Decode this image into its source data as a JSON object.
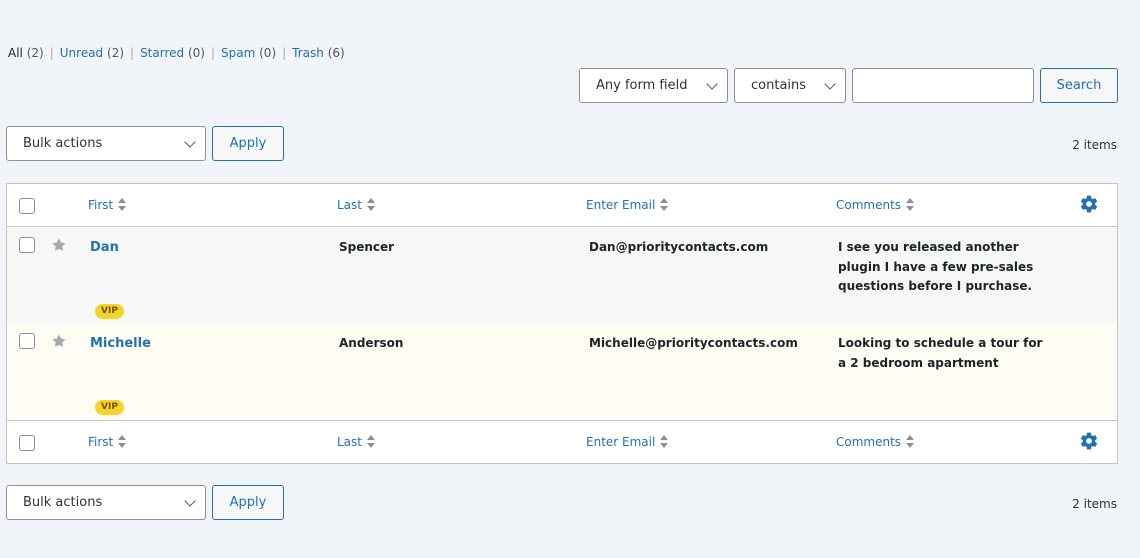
{
  "filters": [
    {
      "label": "All",
      "count": "(2)"
    },
    {
      "label": "Unread",
      "count": "(2)"
    },
    {
      "label": "Starred",
      "count": "(0)"
    },
    {
      "label": "Spam",
      "count": "(0)"
    },
    {
      "label": "Trash",
      "count": "(6)"
    }
  ],
  "search": {
    "field_select": "Any form field",
    "operator_select": "contains",
    "input_value": "",
    "button": "Search"
  },
  "bulk_top": {
    "select": "Bulk actions",
    "apply": "Apply",
    "items": "2 items"
  },
  "bulk_bottom": {
    "select": "Bulk actions",
    "apply": "Apply",
    "items": "2 items"
  },
  "columns": [
    "First",
    "Last",
    "Enter Email",
    "Comments"
  ],
  "rows": [
    {
      "first": "Dan",
      "last": "Spencer",
      "email": "Dan@prioritycontacts.com",
      "comments": "I see you released another plugin I have a few pre-sales questions before I purchase.",
      "badge": "VIP"
    },
    {
      "first": "Michelle",
      "last": "Anderson",
      "email": "Michelle@prioritycontacts.com",
      "comments": "Looking to schedule a tour for a 2 bedroom apartment",
      "badge": "VIP"
    }
  ],
  "icons": {
    "star": "star-icon",
    "gear": "gear-icon",
    "chevron": "chevron-down-icon",
    "sort": "sort-icon"
  },
  "colors": {
    "link": "#2271b1",
    "vip": "#f6d32c",
    "unread_row": "#fffdf3"
  }
}
